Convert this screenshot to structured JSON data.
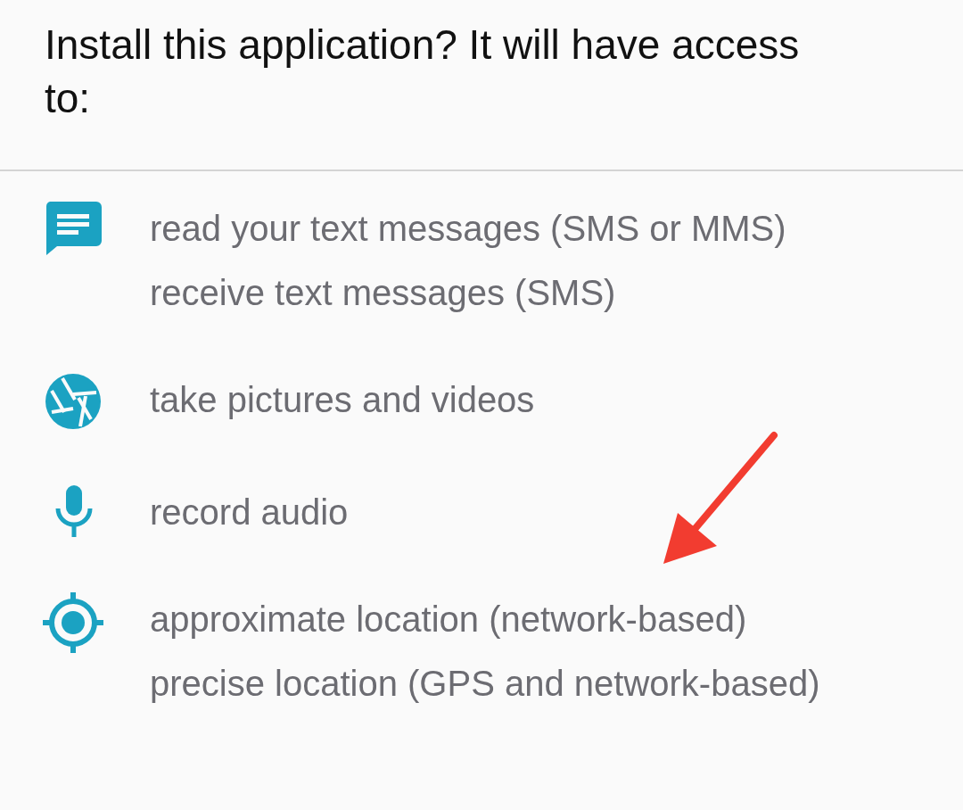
{
  "title": "Install this application? It will have access to:",
  "permissions": [
    {
      "kind": "message",
      "items": [
        "read your text messages (SMS or MMS)",
        "receive text messages (SMS)"
      ]
    },
    {
      "kind": "camera",
      "items": [
        "take pictures and videos"
      ]
    },
    {
      "kind": "mic",
      "items": [
        "record audio"
      ]
    },
    {
      "kind": "location",
      "items": [
        "approximate location (network-based)",
        "precise location (GPS and network-based)"
      ]
    }
  ]
}
